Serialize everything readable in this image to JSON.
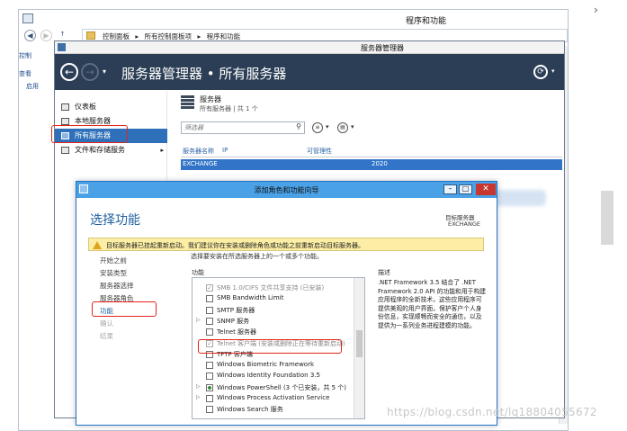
{
  "outer_window": {
    "title": "程序和功能",
    "breadcrumb": [
      "控制面板",
      "▸",
      "所有控制面板项",
      "▸",
      "程序和功能"
    ],
    "sidebar": [
      "控制",
      "查看",
      "启用"
    ]
  },
  "server_manager": {
    "title": "服务器管理器",
    "header": "服务器管理器 • 所有服务器",
    "nav": [
      {
        "label": "仪表板"
      },
      {
        "label": "本地服务器"
      },
      {
        "label": "所有服务器"
      },
      {
        "label": "文件和存储服务",
        "arrow": "▸"
      }
    ],
    "servers_title": "服务器",
    "servers_subtitle": "所有服务器 | 共 1 个",
    "filter_placeholder": "筛选器",
    "columns": [
      "服务器名称",
      "IP",
      "可管理性"
    ],
    "row": {
      "name": "EXCHANGE",
      "year": "2020"
    }
  },
  "wizard": {
    "title": "添加角色和功能向导",
    "heading": "选择功能",
    "target_label": "目标服务器",
    "target_value": "EXCHANGE",
    "warning": "目标服务器已挂起重新启动。我们建议你在安装或删除角色或功能之前重新启动目标服务器。",
    "instruction": "选择要安装在所选服务器上的一个或多个功能。",
    "steps": [
      {
        "label": "开始之前",
        "state": "normal"
      },
      {
        "label": "安装类型",
        "state": "normal"
      },
      {
        "label": "服务器选择",
        "state": "normal"
      },
      {
        "label": "服务器角色",
        "state": "normal"
      },
      {
        "label": "功能",
        "state": "active"
      },
      {
        "label": "确认",
        "state": "disabled"
      },
      {
        "label": "结果",
        "state": "disabled"
      }
    ],
    "features_label": "功能",
    "description_label": "描述",
    "features": [
      {
        "label": "SMB 1.0/CIFS 文件共享支持 (已安装)",
        "state": "checked",
        "grey": true
      },
      {
        "label": "SMB Bandwidth Limit",
        "state": "unchecked"
      },
      {
        "label": "SMTP 服务器",
        "state": "unchecked"
      },
      {
        "label": "SNMP 服务",
        "state": "unchecked",
        "expander": "▷"
      },
      {
        "label": "Telnet 服务器",
        "state": "unchecked"
      },
      {
        "label": "Telnet 客户端 (安装或删除正在等待重新启动)",
        "state": "checked",
        "grey": true
      },
      {
        "label": "TFTP 客户端",
        "state": "unchecked"
      },
      {
        "label": "Windows Biometric Framework",
        "state": "unchecked"
      },
      {
        "label": "Windows Identity Foundation 3.5",
        "state": "unchecked"
      },
      {
        "label": "Windows PowerShell (3 个已安装，共 5 个)",
        "state": "partial",
        "expander": "▷"
      },
      {
        "label": "Windows Process Activation Service",
        "state": "unchecked",
        "expander": "▷"
      },
      {
        "label": "Windows Search 服务",
        "state": "unchecked"
      }
    ],
    "description": ".NET Framework 3.5 结合了 .NET Framework 2.0 API 的功能和用于构建应用程序的全新技术，这些应用程序可提供美观的用户界面，保护客户个人身份信息，实现顺畅而安全的通信，以及提供为一系列业务进程建模的功能。"
  },
  "watermark": "https://blog.csdn.net/lq18804055672",
  "colors": {
    "sm_header": "#2b3e55",
    "nav_selected": "#2e70b9",
    "wizard_title": "#4aa1e6",
    "heading": "#1f5f9f",
    "highlight_box": "#e3241b",
    "warning_bg": "#fcefa5"
  }
}
